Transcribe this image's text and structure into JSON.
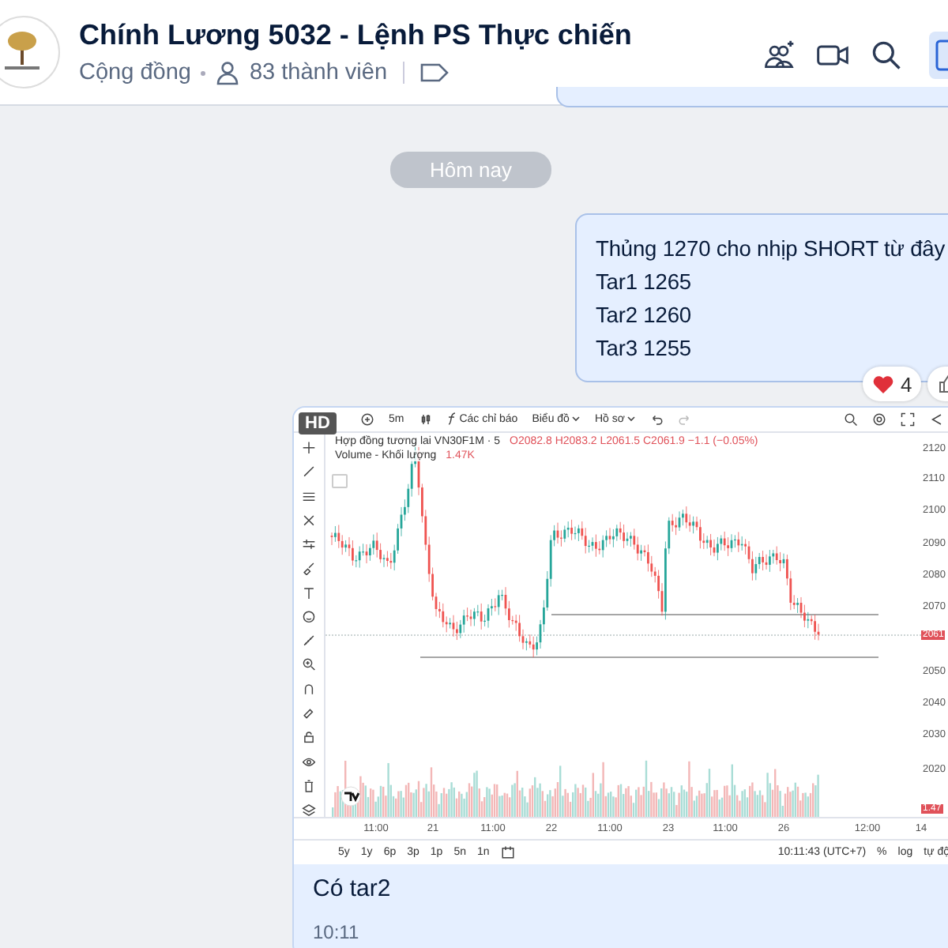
{
  "header": {
    "title": "Chính Lương 5032 - Lệnh PS Thực chiến",
    "community": "Cộng đồng",
    "members": "83 thành viên"
  },
  "date_divider": "Hôm nay",
  "messages": [
    {
      "kind": "text",
      "lines": [
        "Thủng 1270 cho nhịp SHORT từ đây",
        "Tar1 1265",
        "Tar2 1260",
        "Tar3 1255"
      ],
      "reactions": [
        {
          "kind": "heart",
          "count": "4"
        },
        {
          "kind": "like"
        }
      ]
    },
    {
      "kind": "image",
      "badge": "HD",
      "caption": "Có tar2",
      "time": "10:11",
      "chart": {
        "toolbar": {
          "interval": "5m",
          "indicators": "Các chỉ báo",
          "chart_menu": "Biểu đồ",
          "profile": "Hồ sơ"
        },
        "legend": {
          "symbol": "Hợp đồng tương lai VN30F1M · 5",
          "ohlc": "O2082.8 H2083.2 L2061.5 C2061.9 −1.1 (−0.05%)",
          "volume_label": "Volume - Khối lượng",
          "volume_value": "1.47K"
        },
        "price_labels": [
          "2120",
          "2110",
          "2100",
          "2090",
          "2080",
          "2070",
          "2050",
          "2040",
          "2030",
          "2020"
        ],
        "price_tag": "2061",
        "volume_tag": "1.47",
        "time_labels": [
          "11:00",
          "21",
          "11:00",
          "22",
          "11:00",
          "23",
          "11:00",
          "26",
          "12:00",
          "14"
        ],
        "ranges": [
          "5y",
          "1y",
          "6p",
          "3p",
          "1p",
          "5n",
          "1n"
        ],
        "clock": "10:11:43 (UTC+7)",
        "options": [
          "%",
          "log",
          "tự độ"
        ]
      }
    }
  ]
}
